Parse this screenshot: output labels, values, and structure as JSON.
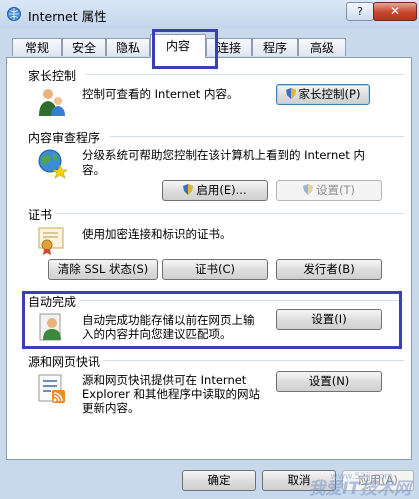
{
  "window": {
    "title": "Internet 属性",
    "help_label": "?",
    "close_label": "✕"
  },
  "tabs": [
    {
      "label": "常规"
    },
    {
      "label": "安全"
    },
    {
      "label": "隐私"
    },
    {
      "label": "内容"
    },
    {
      "label": "连接"
    },
    {
      "label": "程序"
    },
    {
      "label": "高级"
    }
  ],
  "parental": {
    "title": "家长控制",
    "desc": "控制可查看的 Internet 内容。",
    "button": "家长控制(P)"
  },
  "advisor": {
    "title": "内容审查程序",
    "desc_line1": "分级系统可帮助您控制在该计算机上看到的 Internet 内",
    "desc_line2": "容。",
    "enable_button": "启用(E)...",
    "settings_button": "设置(T)"
  },
  "certificates": {
    "title": "证书",
    "desc": "使用加密连接和标识的证书。",
    "clear_ssl_button": "清除 SSL 状态(S)",
    "certs_button": "证书(C)",
    "publishers_button": "发行者(B)"
  },
  "autocomplete": {
    "title": "自动完成",
    "desc_line1": "自动完成功能存储以前在网页上输",
    "desc_line2": "入的内容并向您建议匹配项。",
    "settings_button": "设置(I)"
  },
  "feeds": {
    "title": "源和网页快讯",
    "desc_line1": "源和网页快讯提供可在 Internet",
    "desc_line2": "Explorer 和其他程序中读取的网站",
    "desc_line3": "更新内容。",
    "settings_button": "设置(N)"
  },
  "footer": {
    "ok_button": "确定",
    "cancel_button": "取消",
    "apply_button": "应用(A)"
  },
  "watermark": {
    "text": "我爱IT技术网",
    "sub": "www.52ij.com"
  },
  "colors": {
    "highlight_box": "#3a3fb6",
    "close_red": "#c8452e"
  }
}
